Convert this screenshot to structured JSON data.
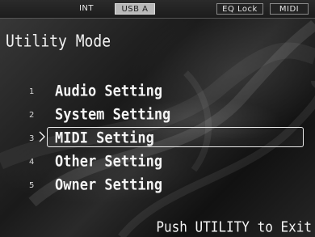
{
  "status_bar": {
    "int_label": "INT",
    "usb_label": "USB A",
    "eq_lock_label": "EQ Lock",
    "midi_label": "MIDI"
  },
  "title": "Utility Mode",
  "menu": {
    "selected_index": 3,
    "items": [
      {
        "number": "1",
        "label": "Audio Setting"
      },
      {
        "number": "2",
        "label": "System Setting"
      },
      {
        "number": "3",
        "label": "MIDI Setting"
      },
      {
        "number": "4",
        "label": "Other Setting"
      },
      {
        "number": "5",
        "label": "Owner Setting"
      }
    ]
  },
  "footer": "Push UTILITY to Exit"
}
